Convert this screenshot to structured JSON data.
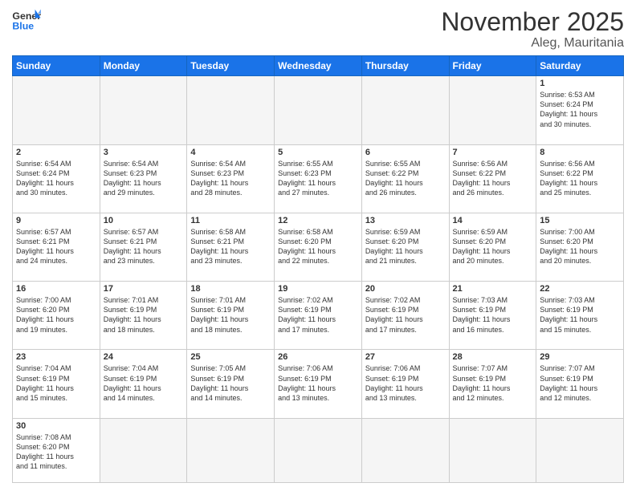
{
  "header": {
    "logo_general": "General",
    "logo_blue": "Blue",
    "month_title": "November 2025",
    "location": "Aleg, Mauritania"
  },
  "days_of_week": [
    "Sunday",
    "Monday",
    "Tuesday",
    "Wednesday",
    "Thursday",
    "Friday",
    "Saturday"
  ],
  "weeks": [
    [
      {
        "day": "",
        "content": ""
      },
      {
        "day": "",
        "content": ""
      },
      {
        "day": "",
        "content": ""
      },
      {
        "day": "",
        "content": ""
      },
      {
        "day": "",
        "content": ""
      },
      {
        "day": "",
        "content": ""
      },
      {
        "day": "1",
        "content": "Sunrise: 6:53 AM\nSunset: 6:24 PM\nDaylight: 11 hours\nand 30 minutes."
      }
    ],
    [
      {
        "day": "2",
        "content": "Sunrise: 6:54 AM\nSunset: 6:24 PM\nDaylight: 11 hours\nand 30 minutes."
      },
      {
        "day": "3",
        "content": "Sunrise: 6:54 AM\nSunset: 6:23 PM\nDaylight: 11 hours\nand 29 minutes."
      },
      {
        "day": "4",
        "content": "Sunrise: 6:54 AM\nSunset: 6:23 PM\nDaylight: 11 hours\nand 28 minutes."
      },
      {
        "day": "5",
        "content": "Sunrise: 6:55 AM\nSunset: 6:23 PM\nDaylight: 11 hours\nand 27 minutes."
      },
      {
        "day": "6",
        "content": "Sunrise: 6:55 AM\nSunset: 6:22 PM\nDaylight: 11 hours\nand 26 minutes."
      },
      {
        "day": "7",
        "content": "Sunrise: 6:56 AM\nSunset: 6:22 PM\nDaylight: 11 hours\nand 26 minutes."
      },
      {
        "day": "8",
        "content": "Sunrise: 6:56 AM\nSunset: 6:22 PM\nDaylight: 11 hours\nand 25 minutes."
      }
    ],
    [
      {
        "day": "9",
        "content": "Sunrise: 6:57 AM\nSunset: 6:21 PM\nDaylight: 11 hours\nand 24 minutes."
      },
      {
        "day": "10",
        "content": "Sunrise: 6:57 AM\nSunset: 6:21 PM\nDaylight: 11 hours\nand 23 minutes."
      },
      {
        "day": "11",
        "content": "Sunrise: 6:58 AM\nSunset: 6:21 PM\nDaylight: 11 hours\nand 23 minutes."
      },
      {
        "day": "12",
        "content": "Sunrise: 6:58 AM\nSunset: 6:20 PM\nDaylight: 11 hours\nand 22 minutes."
      },
      {
        "day": "13",
        "content": "Sunrise: 6:59 AM\nSunset: 6:20 PM\nDaylight: 11 hours\nand 21 minutes."
      },
      {
        "day": "14",
        "content": "Sunrise: 6:59 AM\nSunset: 6:20 PM\nDaylight: 11 hours\nand 20 minutes."
      },
      {
        "day": "15",
        "content": "Sunrise: 7:00 AM\nSunset: 6:20 PM\nDaylight: 11 hours\nand 20 minutes."
      }
    ],
    [
      {
        "day": "16",
        "content": "Sunrise: 7:00 AM\nSunset: 6:20 PM\nDaylight: 11 hours\nand 19 minutes."
      },
      {
        "day": "17",
        "content": "Sunrise: 7:01 AM\nSunset: 6:19 PM\nDaylight: 11 hours\nand 18 minutes."
      },
      {
        "day": "18",
        "content": "Sunrise: 7:01 AM\nSunset: 6:19 PM\nDaylight: 11 hours\nand 18 minutes."
      },
      {
        "day": "19",
        "content": "Sunrise: 7:02 AM\nSunset: 6:19 PM\nDaylight: 11 hours\nand 17 minutes."
      },
      {
        "day": "20",
        "content": "Sunrise: 7:02 AM\nSunset: 6:19 PM\nDaylight: 11 hours\nand 17 minutes."
      },
      {
        "day": "21",
        "content": "Sunrise: 7:03 AM\nSunset: 6:19 PM\nDaylight: 11 hours\nand 16 minutes."
      },
      {
        "day": "22",
        "content": "Sunrise: 7:03 AM\nSunset: 6:19 PM\nDaylight: 11 hours\nand 15 minutes."
      }
    ],
    [
      {
        "day": "23",
        "content": "Sunrise: 7:04 AM\nSunset: 6:19 PM\nDaylight: 11 hours\nand 15 minutes."
      },
      {
        "day": "24",
        "content": "Sunrise: 7:04 AM\nSunset: 6:19 PM\nDaylight: 11 hours\nand 14 minutes."
      },
      {
        "day": "25",
        "content": "Sunrise: 7:05 AM\nSunset: 6:19 PM\nDaylight: 11 hours\nand 14 minutes."
      },
      {
        "day": "26",
        "content": "Sunrise: 7:06 AM\nSunset: 6:19 PM\nDaylight: 11 hours\nand 13 minutes."
      },
      {
        "day": "27",
        "content": "Sunrise: 7:06 AM\nSunset: 6:19 PM\nDaylight: 11 hours\nand 13 minutes."
      },
      {
        "day": "28",
        "content": "Sunrise: 7:07 AM\nSunset: 6:19 PM\nDaylight: 11 hours\nand 12 minutes."
      },
      {
        "day": "29",
        "content": "Sunrise: 7:07 AM\nSunset: 6:19 PM\nDaylight: 11 hours\nand 12 minutes."
      }
    ],
    [
      {
        "day": "30",
        "content": "Sunrise: 7:08 AM\nSunset: 6:20 PM\nDaylight: 11 hours\nand 11 minutes."
      },
      {
        "day": "",
        "content": ""
      },
      {
        "day": "",
        "content": ""
      },
      {
        "day": "",
        "content": ""
      },
      {
        "day": "",
        "content": ""
      },
      {
        "day": "",
        "content": ""
      },
      {
        "day": "",
        "content": ""
      }
    ]
  ]
}
